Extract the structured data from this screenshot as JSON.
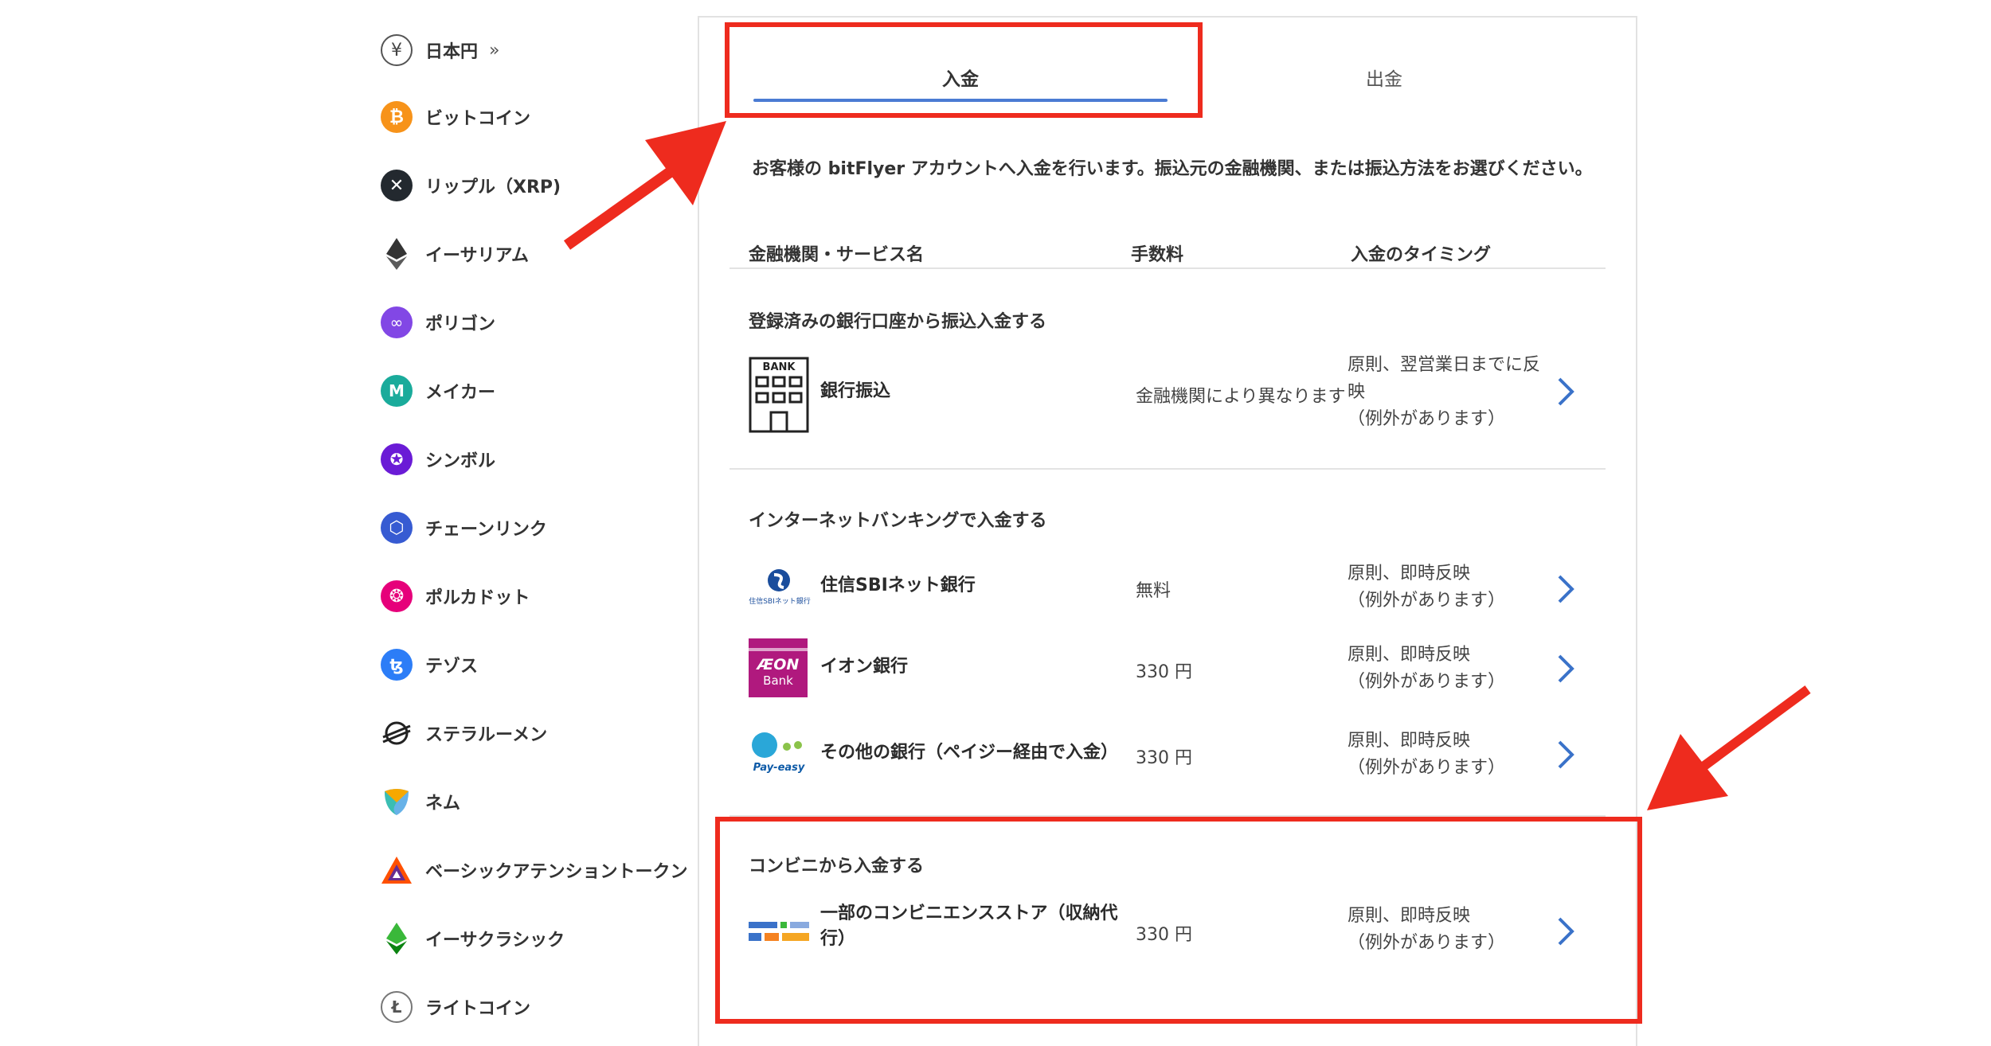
{
  "sidebar": {
    "items": [
      {
        "label": "日本円",
        "icon": "yen-icon",
        "color": "#ffffff"
      },
      {
        "label": "ビットコイン",
        "icon": "bitcoin-icon",
        "color": "#f7931a"
      },
      {
        "label": "リップル（XRP)",
        "icon": "xrp-icon",
        "color": "#23292f"
      },
      {
        "label": "イーサリアム",
        "icon": "ethereum-icon",
        "color": "#3c3c3d"
      },
      {
        "label": "ポリゴン",
        "icon": "polygon-icon",
        "color": "#8247e5"
      },
      {
        "label": "メイカー",
        "icon": "maker-icon",
        "color": "#1aab9b"
      },
      {
        "label": "シンボル",
        "icon": "symbol-icon",
        "color": "#6a1bd6"
      },
      {
        "label": "チェーンリンク",
        "icon": "chainlink-icon",
        "color": "#375bd2"
      },
      {
        "label": "ポルカドット",
        "icon": "polkadot-icon",
        "color": "#e6007a"
      },
      {
        "label": "テゾス",
        "icon": "tezos-icon",
        "color": "#2c7df7"
      },
      {
        "label": "ステラルーメン",
        "icon": "stellar-icon",
        "color": "#222222"
      },
      {
        "label": "ネム",
        "icon": "nem-icon",
        "color": "#67b2e8"
      },
      {
        "label": "ベーシックアテンショントークン",
        "icon": "bat-icon",
        "color": "#ff5000"
      },
      {
        "label": "イーサクラシック",
        "icon": "ethereum-classic-icon",
        "color": "#3ab83a"
      },
      {
        "label": "ライトコイン",
        "icon": "litecoin-icon",
        "color": "#a6a9aa"
      }
    ],
    "expand_glyph": "»"
  },
  "tabs": {
    "deposit": "入金",
    "withdraw": "出金"
  },
  "lead": "お客様の bitFlyer アカウントへ入金を行います。振込元の金融機関、または振込方法をお選びください。",
  "columns": {
    "name": "金融機関・サービス名",
    "fee": "手数料",
    "timing": "入金のタイミング"
  },
  "sections": {
    "registered": {
      "title": "登録済みの銀行口座から振込入金する",
      "rows": [
        {
          "name": "銀行振込",
          "fee": "金融機関により異なります",
          "timing_lines": [
            "原則、翌営業日までに反",
            "映",
            "（例外があります）"
          ],
          "logo_text": "BANK"
        }
      ]
    },
    "internet": {
      "title": "インターネットバンキングで入金する",
      "rows": [
        {
          "name": "住信SBIネット銀行",
          "fee": "無料",
          "timing_lines": [
            "原則、即時反映",
            "（例外があります）"
          ],
          "logo_text": "住信SBIネット銀行"
        },
        {
          "name": "イオン銀行",
          "fee": "330 円",
          "timing_lines": [
            "原則、即時反映",
            "（例外があります）"
          ],
          "logo_text": "ÆON",
          "logo_sub": "Bank"
        },
        {
          "name": "その他の銀行（ペイジー経由で入金）",
          "fee": "330 円",
          "timing_lines": [
            "原則、即時反映",
            "（例外があります）"
          ],
          "logo_text": "Pay-easy"
        }
      ]
    },
    "convenience": {
      "title": "コンビニから入金する",
      "rows": [
        {
          "name_lines": [
            "一部のコンビニエンスストア（収納代",
            "行）"
          ],
          "fee": "330 円",
          "timing_lines": [
            "原則、即時反映",
            "（例外があります）"
          ]
        }
      ]
    }
  },
  "colors": {
    "accent": "#4a7bd3",
    "annotation": "#ee2b1e",
    "chevron": "#3a72c9"
  }
}
